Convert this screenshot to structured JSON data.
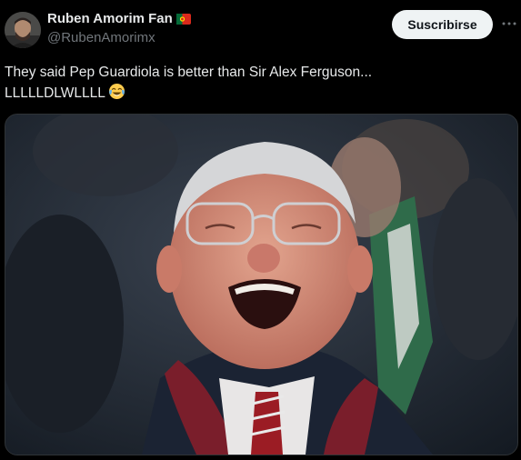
{
  "author": {
    "display_name": "Ruben Amorim Fan",
    "handle": "@RubenAmorimx",
    "flag_icon": "portugal-flag-icon",
    "avatar_icon": "avatar"
  },
  "actions": {
    "subscribe_label": "Suscribirse",
    "more_icon": "more-options-icon"
  },
  "tweet": {
    "line1": "They said Pep Guardiola is better than Sir Alex Ferguson...",
    "line2": "LLLLLDLWLLLL",
    "emoji_icon": "face-with-tears-of-joy-emoji"
  },
  "media": {
    "alt": "Photo of an elderly man with glasses laughing, wearing a burgundy scarf, in a stadium crowd"
  },
  "colors": {
    "background": "#000000",
    "text_primary": "#e7e9ea",
    "text_secondary": "#71767b",
    "button_bg": "#eff3f4"
  }
}
